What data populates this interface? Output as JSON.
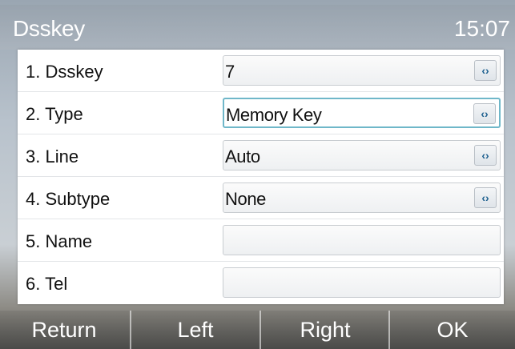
{
  "header": {
    "title": "Dsskey",
    "time": "15:07"
  },
  "rows": [
    {
      "number": "1.",
      "label": "Dsskey",
      "value": "7",
      "selector": true
    },
    {
      "number": "2.",
      "label": "Type",
      "value": "Memory Key",
      "selector": true,
      "focused": true
    },
    {
      "number": "3.",
      "label": "Line",
      "value": "Auto",
      "selector": true
    },
    {
      "number": "4.",
      "label": "Subtype",
      "value": "None",
      "selector": true
    },
    {
      "number": "5.",
      "label": "Name",
      "value": "",
      "selector": false
    },
    {
      "number": "6.",
      "label": "Tel",
      "value": "",
      "selector": false
    }
  ],
  "selector_glyph": "‹›",
  "softkeys": {
    "return": "Return",
    "left": "Left",
    "right": "Right",
    "ok": "OK"
  },
  "colors": {
    "focus_border": "#6fb7c9",
    "arrow_glyph": "#1a5e8e"
  }
}
